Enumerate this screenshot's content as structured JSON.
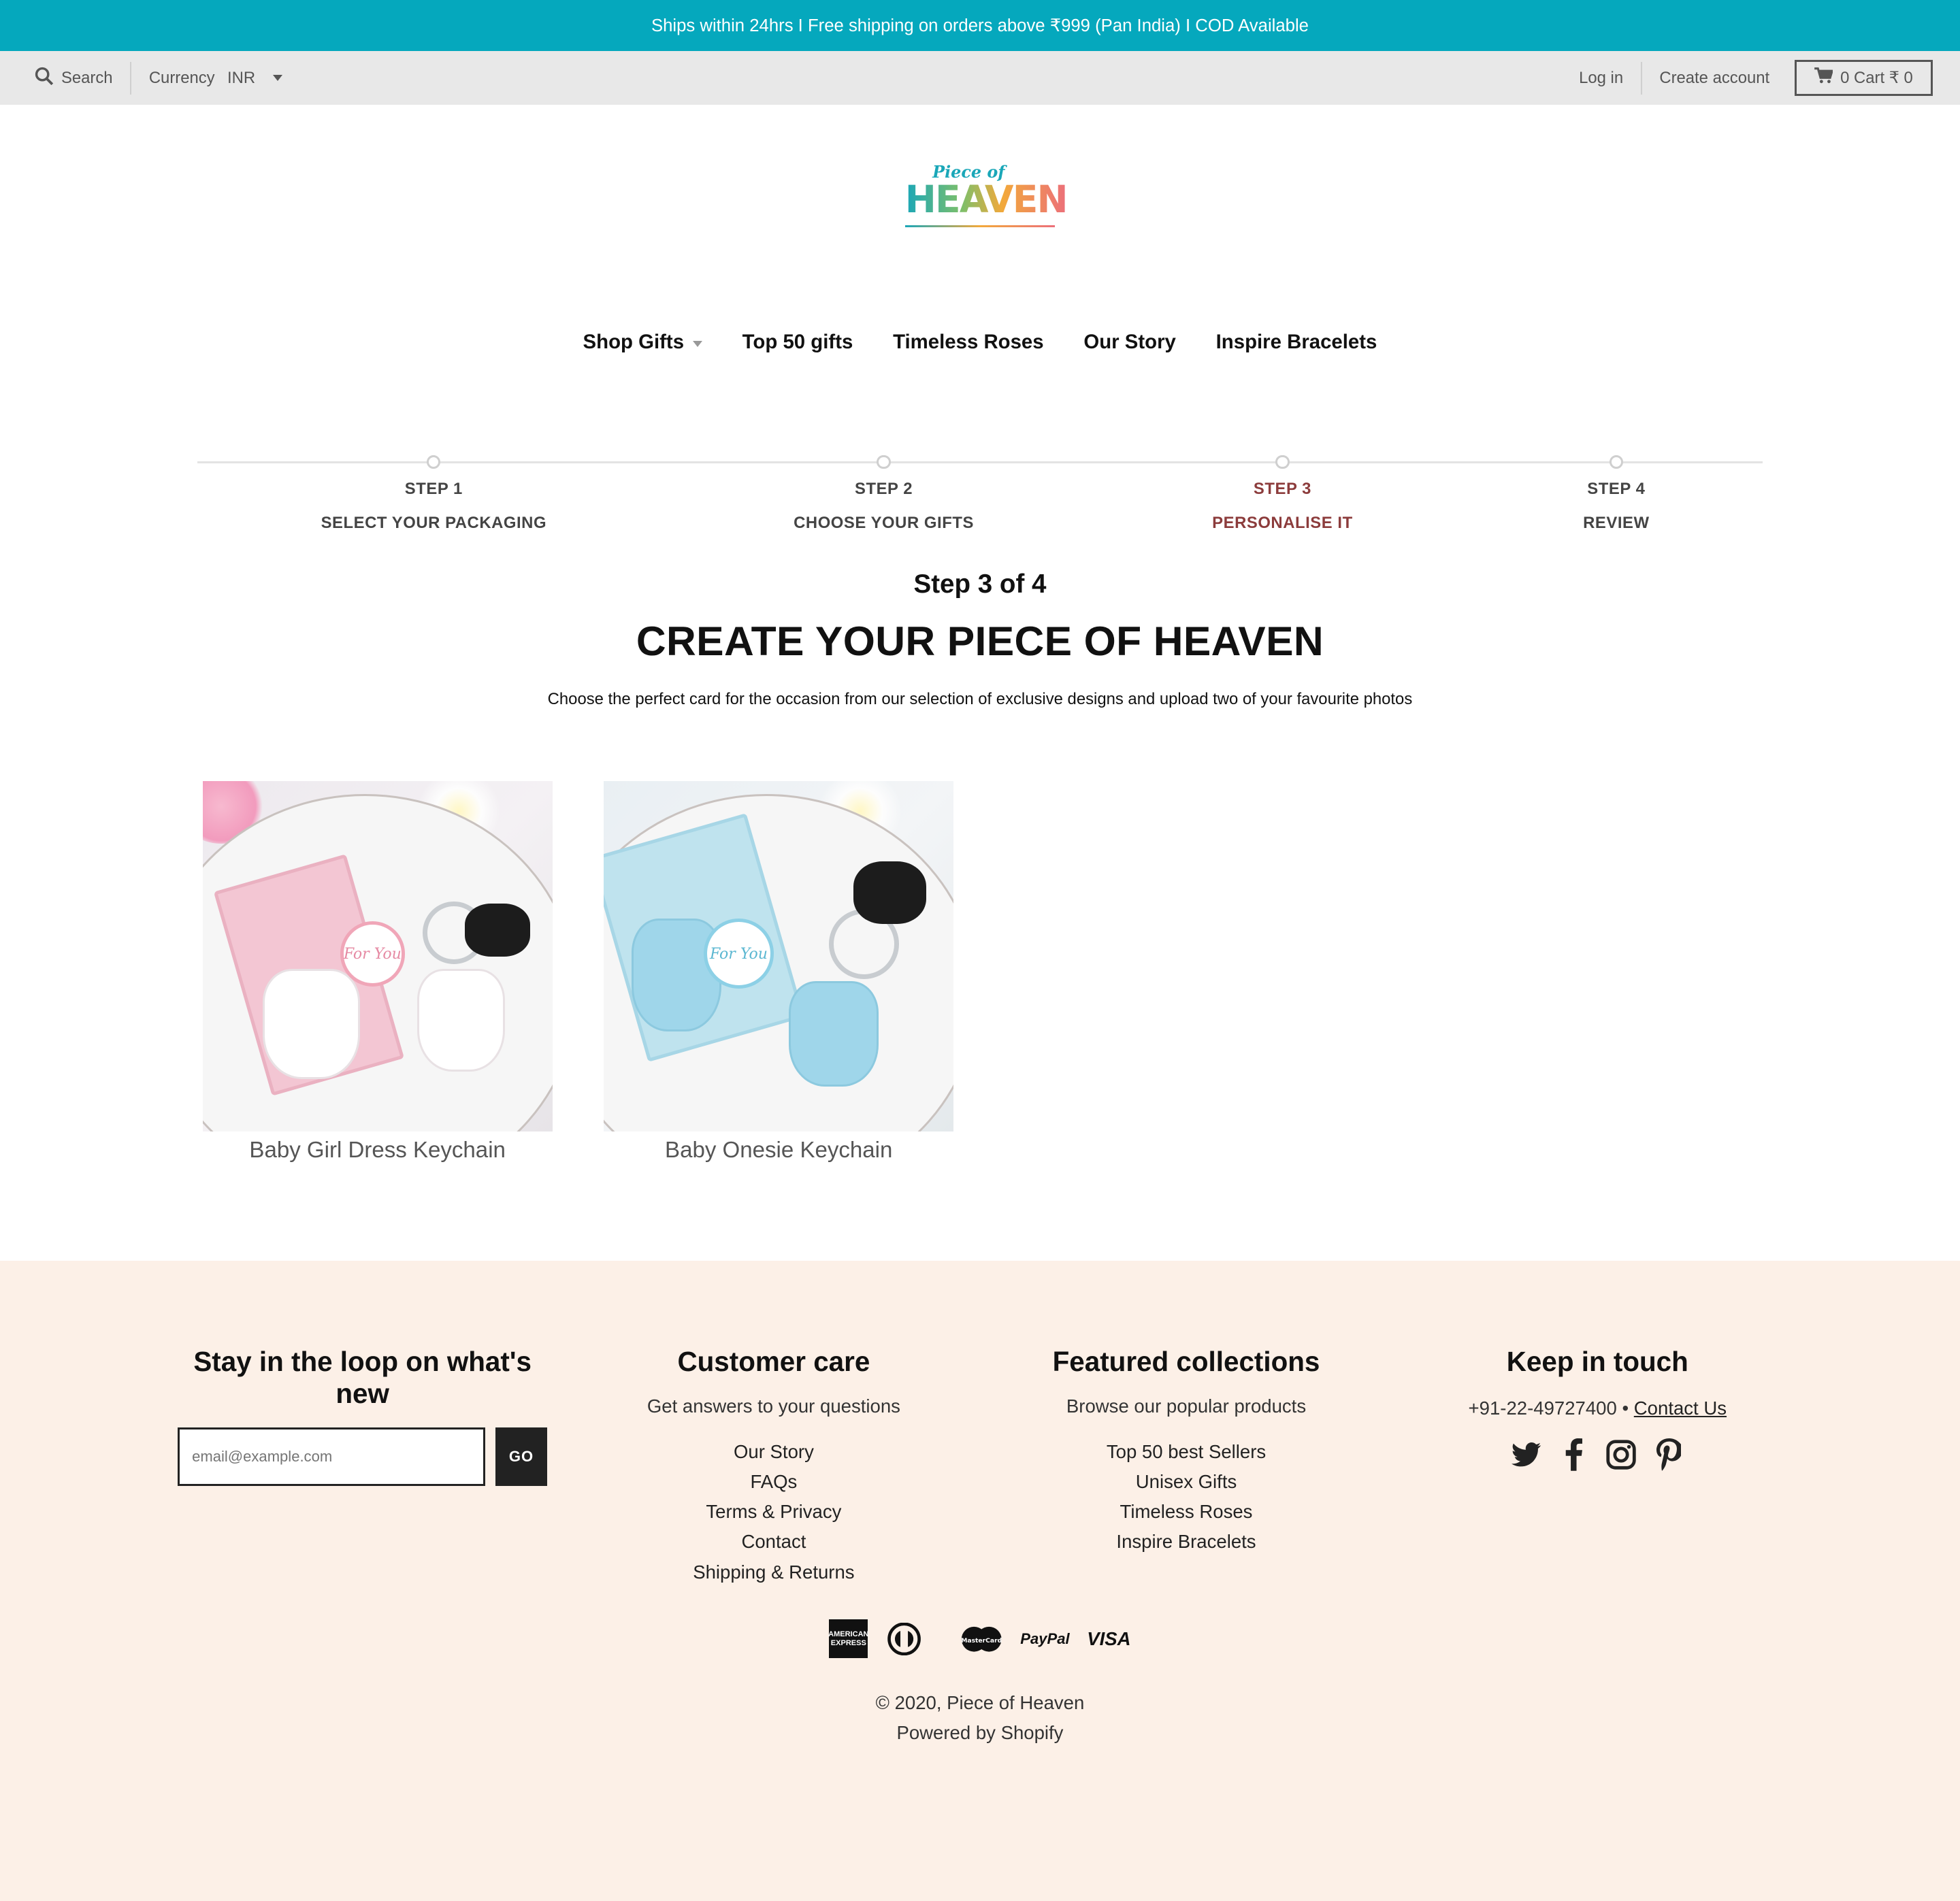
{
  "announcement": "Ships within 24hrs I Free shipping on orders above ₹999 (Pan India) I COD Available",
  "utility": {
    "search_label": "Search",
    "currency_label": "Currency",
    "currency_value": "INR",
    "login": "Log in",
    "create_account": "Create account",
    "cart": "0 Cart ₹ 0"
  },
  "logo": {
    "small": "Piece of",
    "large": "HEAVEN"
  },
  "nav": [
    {
      "label": "Shop Gifts",
      "has_dropdown": true
    },
    {
      "label": "Top 50 gifts"
    },
    {
      "label": "Timeless Roses"
    },
    {
      "label": "Our Story"
    },
    {
      "label": "Inspire Bracelets"
    }
  ],
  "steps": [
    {
      "num": "STEP 1",
      "title": "SELECT YOUR PACKAGING",
      "active": false
    },
    {
      "num": "STEP 2",
      "title": "CHOOSE YOUR GIFTS",
      "active": false
    },
    {
      "num": "STEP 3",
      "title": "PERSONALISE IT",
      "active": true
    },
    {
      "num": "STEP 4",
      "title": "REVIEW",
      "active": false
    }
  ],
  "main": {
    "step_of": "Step 3 of 4",
    "headline": "CREATE YOUR PIECE OF HEAVEN",
    "subtext": "Choose the perfect card for the occasion from our selection of exclusive designs and upload two of your favourite photos"
  },
  "products": [
    {
      "name": "Baby Girl Dress Keychain",
      "tag_text": "For You"
    },
    {
      "name": "Baby Onesie Keychain",
      "tag_text": "For You"
    }
  ],
  "footer": {
    "newsletter": {
      "heading": "Stay in the loop on what's new",
      "placeholder": "email@example.com",
      "button": "GO"
    },
    "customer_care": {
      "heading": "Customer care",
      "desc": "Get answers to your questions",
      "links": [
        "Our Story",
        "FAQs",
        "Terms & Privacy",
        "Contact",
        "Shipping & Returns"
      ]
    },
    "featured": {
      "heading": "Featured collections",
      "desc": "Browse our popular products",
      "links": [
        "Top 50 best Sellers",
        "Unisex Gifts",
        "Timeless Roses",
        "Inspire Bracelets"
      ]
    },
    "keep_in_touch": {
      "heading": "Keep in touch",
      "phone": "+91-22-49727400 •",
      "contact_link": "Contact Us",
      "social": [
        "twitter-icon",
        "facebook-icon",
        "instagram-icon",
        "pinterest-icon"
      ]
    },
    "payments": [
      "American Express",
      "Diners Club",
      "MasterCard",
      "PayPal",
      "VISA"
    ],
    "copyright": "© 2020, Piece of Heaven",
    "powered": "Powered by Shopify"
  },
  "colors": {
    "announcement_bg": "#05a8bd",
    "active_step": "#8c3c3c",
    "footer_bg": "#fcf0e7",
    "utility_bg": "#e8e8e8"
  }
}
